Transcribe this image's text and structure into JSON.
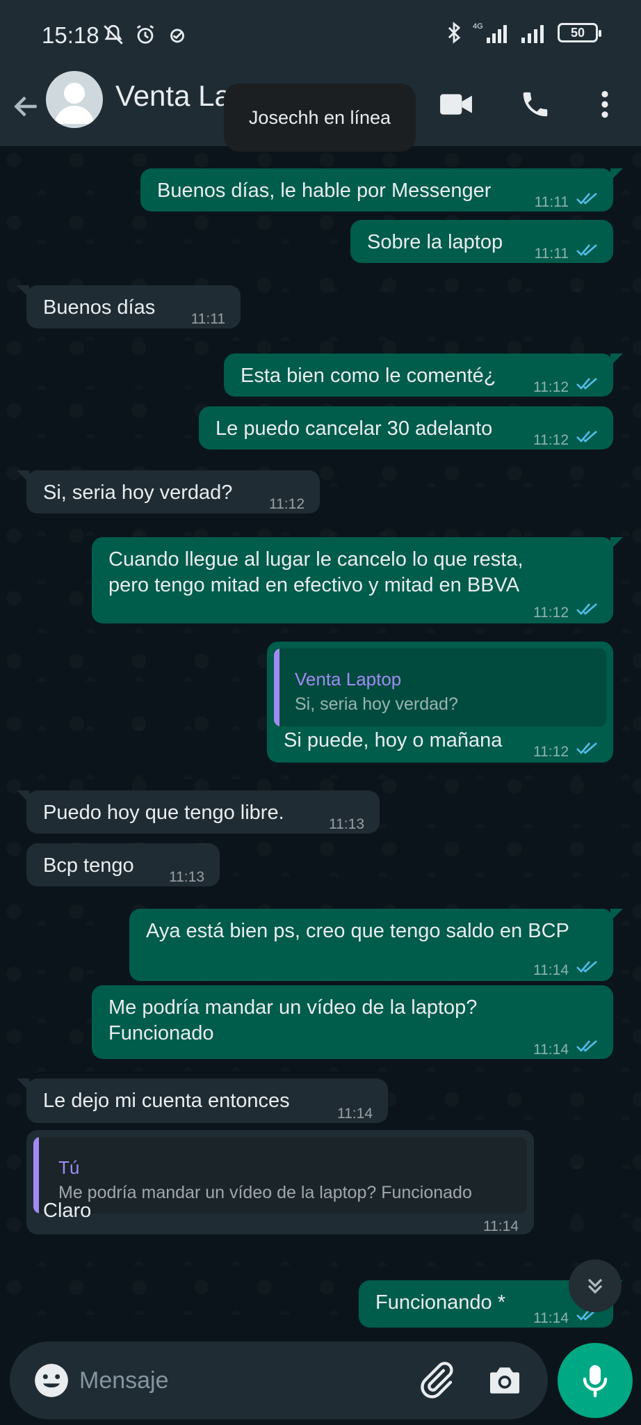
{
  "status_bar": {
    "time": "15:18",
    "network": "4G",
    "battery": "50"
  },
  "header": {
    "title": "Venta La",
    "toast": "Josechh en línea"
  },
  "messages": [
    {
      "dir": "out",
      "text": "Buenos días, le hable por Messenger",
      "time": "11:11"
    },
    {
      "dir": "out",
      "text": "Sobre la laptop",
      "time": "11:11"
    },
    {
      "dir": "in",
      "text": "Buenos días",
      "time": "11:11"
    },
    {
      "dir": "out",
      "text": "Esta bien como le comenté¿",
      "time": "11:12"
    },
    {
      "dir": "out",
      "text": "Le puedo cancelar 30 adelanto",
      "time": "11:12"
    },
    {
      "dir": "in",
      "text": "Si, seria hoy verdad?",
      "time": "11:12"
    },
    {
      "dir": "out",
      "text": "Cuando llegue al lugar le cancelo lo que resta,\npero tengo mitad en efectivo y mitad en BBVA",
      "time": "11:12"
    },
    {
      "dir": "out",
      "text": "Si puede, hoy o mañana",
      "time": "11:12",
      "quote": {
        "name": "Venta Laptop",
        "text": "Si, seria hoy verdad?"
      }
    },
    {
      "dir": "in",
      "text": "Puedo hoy que tengo libre.",
      "time": "11:13"
    },
    {
      "dir": "in",
      "text": "Bcp tengo",
      "time": "11:13"
    },
    {
      "dir": "out",
      "text": "Aya está bien ps, creo que tengo saldo en BCP",
      "time": "11:14"
    },
    {
      "dir": "out",
      "text": "Me podría mandar un vídeo de la laptop?\nFuncionado",
      "time": "11:14"
    },
    {
      "dir": "in",
      "text": "Le dejo mi cuenta entonces",
      "time": "11:14"
    },
    {
      "dir": "in",
      "text": "Claro",
      "time": "11:14",
      "quote": {
        "name": "Tú",
        "text": "Me podría mandar un vídeo de la laptop? Funcionado"
      }
    },
    {
      "dir": "out",
      "text": "Funcionando *",
      "time": "11:14"
    }
  ],
  "composer": {
    "placeholder": "Mensaje"
  },
  "colors": {
    "outgoing": "#005c4b",
    "incoming": "#202c33",
    "accent": "#00a884",
    "read_ticks": "#53bdeb",
    "quote_name": "#a18bf3"
  },
  "icons": [
    "back-arrow-icon",
    "video-call-icon",
    "phone-icon",
    "more-options-icon",
    "emoji-icon",
    "attach-clip-icon",
    "camera-icon",
    "mic-icon",
    "scroll-down-icon"
  ]
}
